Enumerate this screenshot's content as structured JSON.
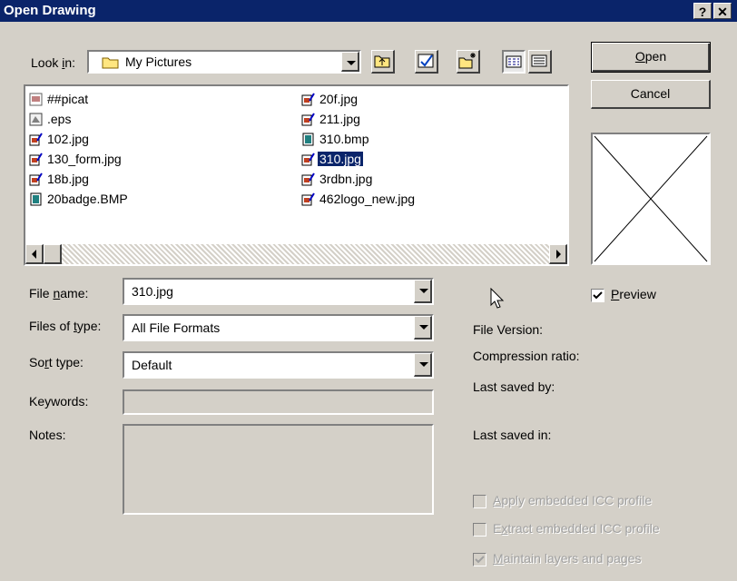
{
  "window": {
    "title": "Open Drawing",
    "help_label": "?",
    "close_label": "✕"
  },
  "look_in": {
    "label_pre": "Look ",
    "label_key": "i",
    "label_post": "n:",
    "value": "My Pictures"
  },
  "toolbar": {
    "up_icon": "up-folder-icon",
    "favorites_icon": "favorites-icon",
    "new_folder_icon": "new-folder-icon",
    "list_icon": "list-view-icon",
    "details_icon": "details-view-icon"
  },
  "files": [
    {
      "name": "##picat",
      "icon": "image-file-icon"
    },
    {
      "name": ".eps",
      "icon": "eps-file-icon"
    },
    {
      "name": "102.jpg",
      "icon": "jpg-file-icon"
    },
    {
      "name": "130_form.jpg",
      "icon": "jpg-file-icon"
    },
    {
      "name": "18b.jpg",
      "icon": "jpg-file-icon"
    },
    {
      "name": "20badge.BMP",
      "icon": "bmp-file-icon"
    },
    {
      "name": "20f.jpg",
      "icon": "jpg-file-icon"
    },
    {
      "name": "211.jpg",
      "icon": "jpg-file-icon"
    },
    {
      "name": "310.bmp",
      "icon": "bmp-file-icon"
    },
    {
      "name": "310.jpg",
      "icon": "jpg-file-icon",
      "selected": true
    },
    {
      "name": "3rdbn.jpg",
      "icon": "jpg-file-icon"
    },
    {
      "name": "462logo_new.jpg",
      "icon": "jpg-file-icon"
    }
  ],
  "buttons": {
    "open_key": "O",
    "open_rest": "pen",
    "cancel": "Cancel"
  },
  "fields": {
    "file_name": {
      "label_pre": "File ",
      "label_key": "n",
      "label_post": "ame:",
      "value": "310.jpg"
    },
    "file_type": {
      "label_pre": "Files of ",
      "label_key": "t",
      "label_post": "ype:",
      "value": "All File Formats"
    },
    "sort_type": {
      "label_pre": "So",
      "label_key": "r",
      "label_post": "t type:",
      "value": "Default"
    },
    "keywords": {
      "label": "Keywords:",
      "value": ""
    },
    "notes": {
      "label": "Notes:",
      "value": ""
    }
  },
  "preview": {
    "label_key": "P",
    "label_rest": "review",
    "checked": true
  },
  "info": {
    "file_version": "File Version:",
    "compression": "Compression ratio:",
    "saved_by": "Last saved by:",
    "saved_in": "Last saved in:"
  },
  "options": {
    "apply_icc": {
      "key": "A",
      "rest": "pply embedded ICC profile",
      "checked": false,
      "enabled": false
    },
    "extract_icc": {
      "pre": "E",
      "key": "x",
      "rest": "tract embedded ICC profile",
      "checked": false,
      "enabled": false
    },
    "maintain_layers": {
      "key": "M",
      "rest": "aintain layers and pages",
      "checked": true,
      "enabled": false
    }
  }
}
